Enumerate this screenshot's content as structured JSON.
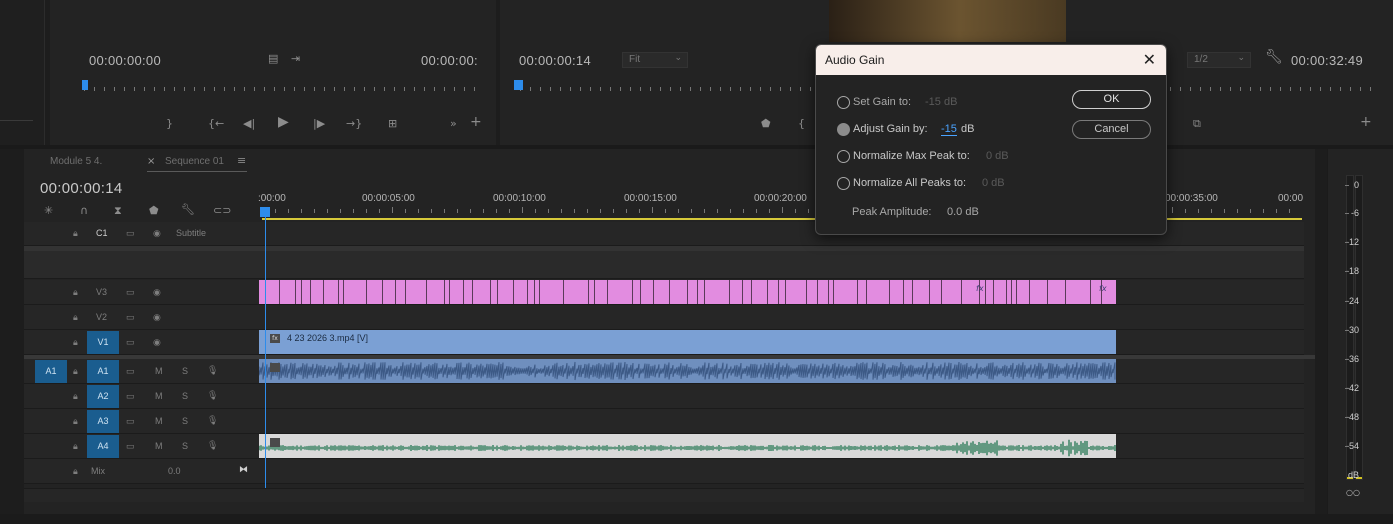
{
  "source_monitor": {
    "timecode_in": "00:00:00:00",
    "timecode_out": "00:00:00:"
  },
  "program_monitor": {
    "timecode": "00:00:00:14",
    "fit": "Fit",
    "resolution": "1/2",
    "duration": "00:00:32:49"
  },
  "timeline": {
    "tabs": [
      {
        "label": "Module 5 4."
      },
      {
        "label": "Sequence 01"
      }
    ],
    "timecode": "00:00:00:14",
    "ruler": [
      ":00:00",
      "00:00:05:00",
      "00:00:10:00",
      "00:00:15:00",
      "00:00:20:00",
      "00:00:35:00",
      "00:00"
    ],
    "tracks": {
      "c1": {
        "label": "C1",
        "name": "Subtitle"
      },
      "v3": "V3",
      "v2": "V2",
      "v1": "V1",
      "a1": "A1",
      "a2": "A2",
      "a3": "A3",
      "a4": "A4",
      "src_a1": "A1",
      "m": "M",
      "s": "S",
      "mix": "Mix",
      "mix_value": "0.0"
    },
    "clip_v1": "4 23 2026 3.mp4 [V]",
    "fx": "fx"
  },
  "meter": {
    "labels": [
      "0",
      "-6",
      "-12",
      "-18",
      "-24",
      "-30",
      "-36",
      "-42",
      "-48",
      "-54",
      "dB"
    ]
  },
  "dialog": {
    "title": "Audio Gain",
    "set_gain_label": "Set Gain to:",
    "set_gain_value": "-15 dB",
    "adjust_gain_label": "Adjust Gain by:",
    "adjust_gain_value": "-15",
    "adjust_gain_unit": "dB",
    "norm_max_label": "Normalize Max Peak to:",
    "norm_max_value": "0 dB",
    "norm_all_label": "Normalize All Peaks to:",
    "norm_all_value": "0 dB",
    "peak_label": "Peak Amplitude:",
    "peak_value": "0.0 dB",
    "ok": "OK",
    "cancel": "Cancel",
    "selected": "adjust_gain"
  },
  "colors": {
    "accent": "#2d8ceb",
    "v3_clip": "#e28ce0",
    "v1_clip": "#7ba0d4",
    "a4_clip": "#2f7d5b",
    "playhead": "#2d8ceb"
  }
}
